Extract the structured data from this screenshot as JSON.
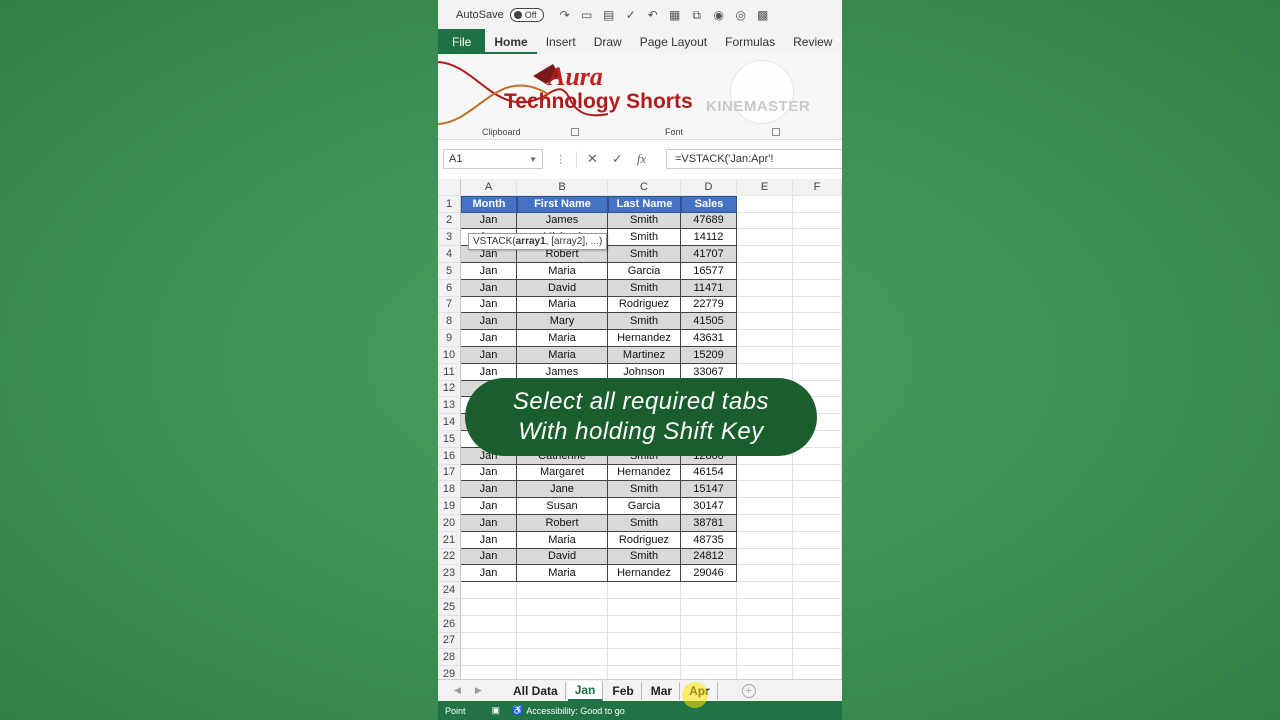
{
  "titlebar": {
    "autosave_label": "AutoSave",
    "autosave_state": "Off"
  },
  "ribbon_tabs": [
    "File",
    "Home",
    "Insert",
    "Draw",
    "Page Layout",
    "Formulas",
    "Review"
  ],
  "ribbon": {
    "clipboard_label": "Clipboard",
    "font_label": "Font"
  },
  "logo": {
    "line1": "Aura",
    "line2": "Technology Shorts"
  },
  "watermark": "KINEMASTER",
  "formula_bar": {
    "name_box": "A1",
    "formula": "=VSTACK('Jan:Apr'!"
  },
  "columns": [
    "A",
    "B",
    "C",
    "D",
    "E",
    "F"
  ],
  "table": {
    "headers": [
      "Month",
      "First Name",
      "Last Name",
      "Sales"
    ],
    "rows": [
      [
        "Jan",
        "James",
        "Smith",
        "47689"
      ],
      [
        "Jan",
        "Michael",
        "Smith",
        "14112"
      ],
      [
        "Jan",
        "Robert",
        "Smith",
        "41707"
      ],
      [
        "Jan",
        "Maria",
        "Garcia",
        "16577"
      ],
      [
        "Jan",
        "David",
        "Smith",
        "11471"
      ],
      [
        "Jan",
        "Maria",
        "Rodriguez",
        "22779"
      ],
      [
        "Jan",
        "Mary",
        "Smith",
        "41505"
      ],
      [
        "Jan",
        "Maria",
        "Hernandez",
        "43631"
      ],
      [
        "Jan",
        "Maria",
        "Martinez",
        "15209"
      ],
      [
        "Jan",
        "James",
        "Johnson",
        "33067"
      ],
      [
        "",
        "",
        "",
        ""
      ],
      [
        "",
        "",
        "",
        ""
      ],
      [
        "",
        "",
        "",
        ""
      ],
      [
        "",
        "",
        "",
        ""
      ],
      [
        "Jan",
        "Catherine",
        "Smith",
        "12860"
      ],
      [
        "Jan",
        "Margaret",
        "Hernandez",
        "46154"
      ],
      [
        "Jan",
        "Jane",
        "Smith",
        "15147"
      ],
      [
        "Jan",
        "Susan",
        "Garcia",
        "30147"
      ],
      [
        "Jan",
        "Robert",
        "Smith",
        "38781"
      ],
      [
        "Jan",
        "Maria",
        "Rodriguez",
        "48735"
      ],
      [
        "Jan",
        "David",
        "Smith",
        "24812"
      ],
      [
        "Jan",
        "Maria",
        "Hernandez",
        "29046"
      ]
    ]
  },
  "tooltip": {
    "prefix": "VSTACK(",
    "bold": "array1",
    "suffix": ", [array2], ...)"
  },
  "caption": {
    "line1": "Select all required tabs",
    "line2": "With holding Shift Key"
  },
  "sheet_tabs": [
    "All Data",
    "Jan",
    "Feb",
    "Mar",
    "Apr"
  ],
  "status": {
    "mode": "Point",
    "accessibility": "Accessibility: Good to go"
  }
}
